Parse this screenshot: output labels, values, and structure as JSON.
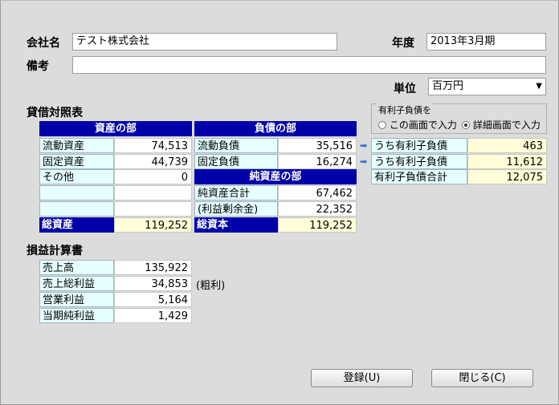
{
  "header": {
    "company_label": "会社名",
    "company_value": "テスト株式会社",
    "year_label": "年度",
    "year_value": "2013年3月期",
    "note_label": "備考",
    "note_value": "",
    "unit_label": "単位",
    "unit_value": "百万円"
  },
  "balance_sheet": {
    "title": "貸借対照表",
    "assets_header": "資産の部",
    "liabilities_header": "負債の部",
    "net_assets_header": "純資産の部",
    "assets": [
      {
        "label": "流動資産",
        "value": "74,513"
      },
      {
        "label": "固定資産",
        "value": "44,739"
      },
      {
        "label": "その他",
        "value": "0"
      },
      {
        "label": "",
        "value": ""
      },
      {
        "label": "",
        "value": ""
      }
    ],
    "liabilities": [
      {
        "label": "流動負債",
        "value": "35,516"
      },
      {
        "label": "固定負債",
        "value": "16,274"
      }
    ],
    "net_assets": [
      {
        "label": "純資産合計",
        "value": "67,462"
      },
      {
        "label": "(利益剰余金)",
        "value": "22,352"
      }
    ],
    "total_assets_label": "総資産",
    "total_assets_value": "119,252",
    "total_capital_label": "総資本",
    "total_capital_value": "119,252"
  },
  "interest_debt": {
    "group_label": "有利子負債を",
    "radio_screen": "この画面で入力",
    "radio_detail": "詳細画面で入力",
    "selected": "detail",
    "rows": [
      {
        "label": "うち有利子負債",
        "value": "463"
      },
      {
        "label": "うち有利子負債",
        "value": "11,612"
      },
      {
        "label": "有利子負債合計",
        "value": "12,075"
      }
    ]
  },
  "income_statement": {
    "title": "損益計算書",
    "rows": [
      {
        "label": "売上高",
        "value": "135,922"
      },
      {
        "label": "売上総利益",
        "value": "34,853"
      },
      {
        "label": "営業利益",
        "value": "5,164"
      },
      {
        "label": "当期純利益",
        "value": "1,429"
      }
    ],
    "gross_note": "(粗利)"
  },
  "buttons": {
    "register": "登録(U)",
    "close": "閉じる(C)"
  }
}
